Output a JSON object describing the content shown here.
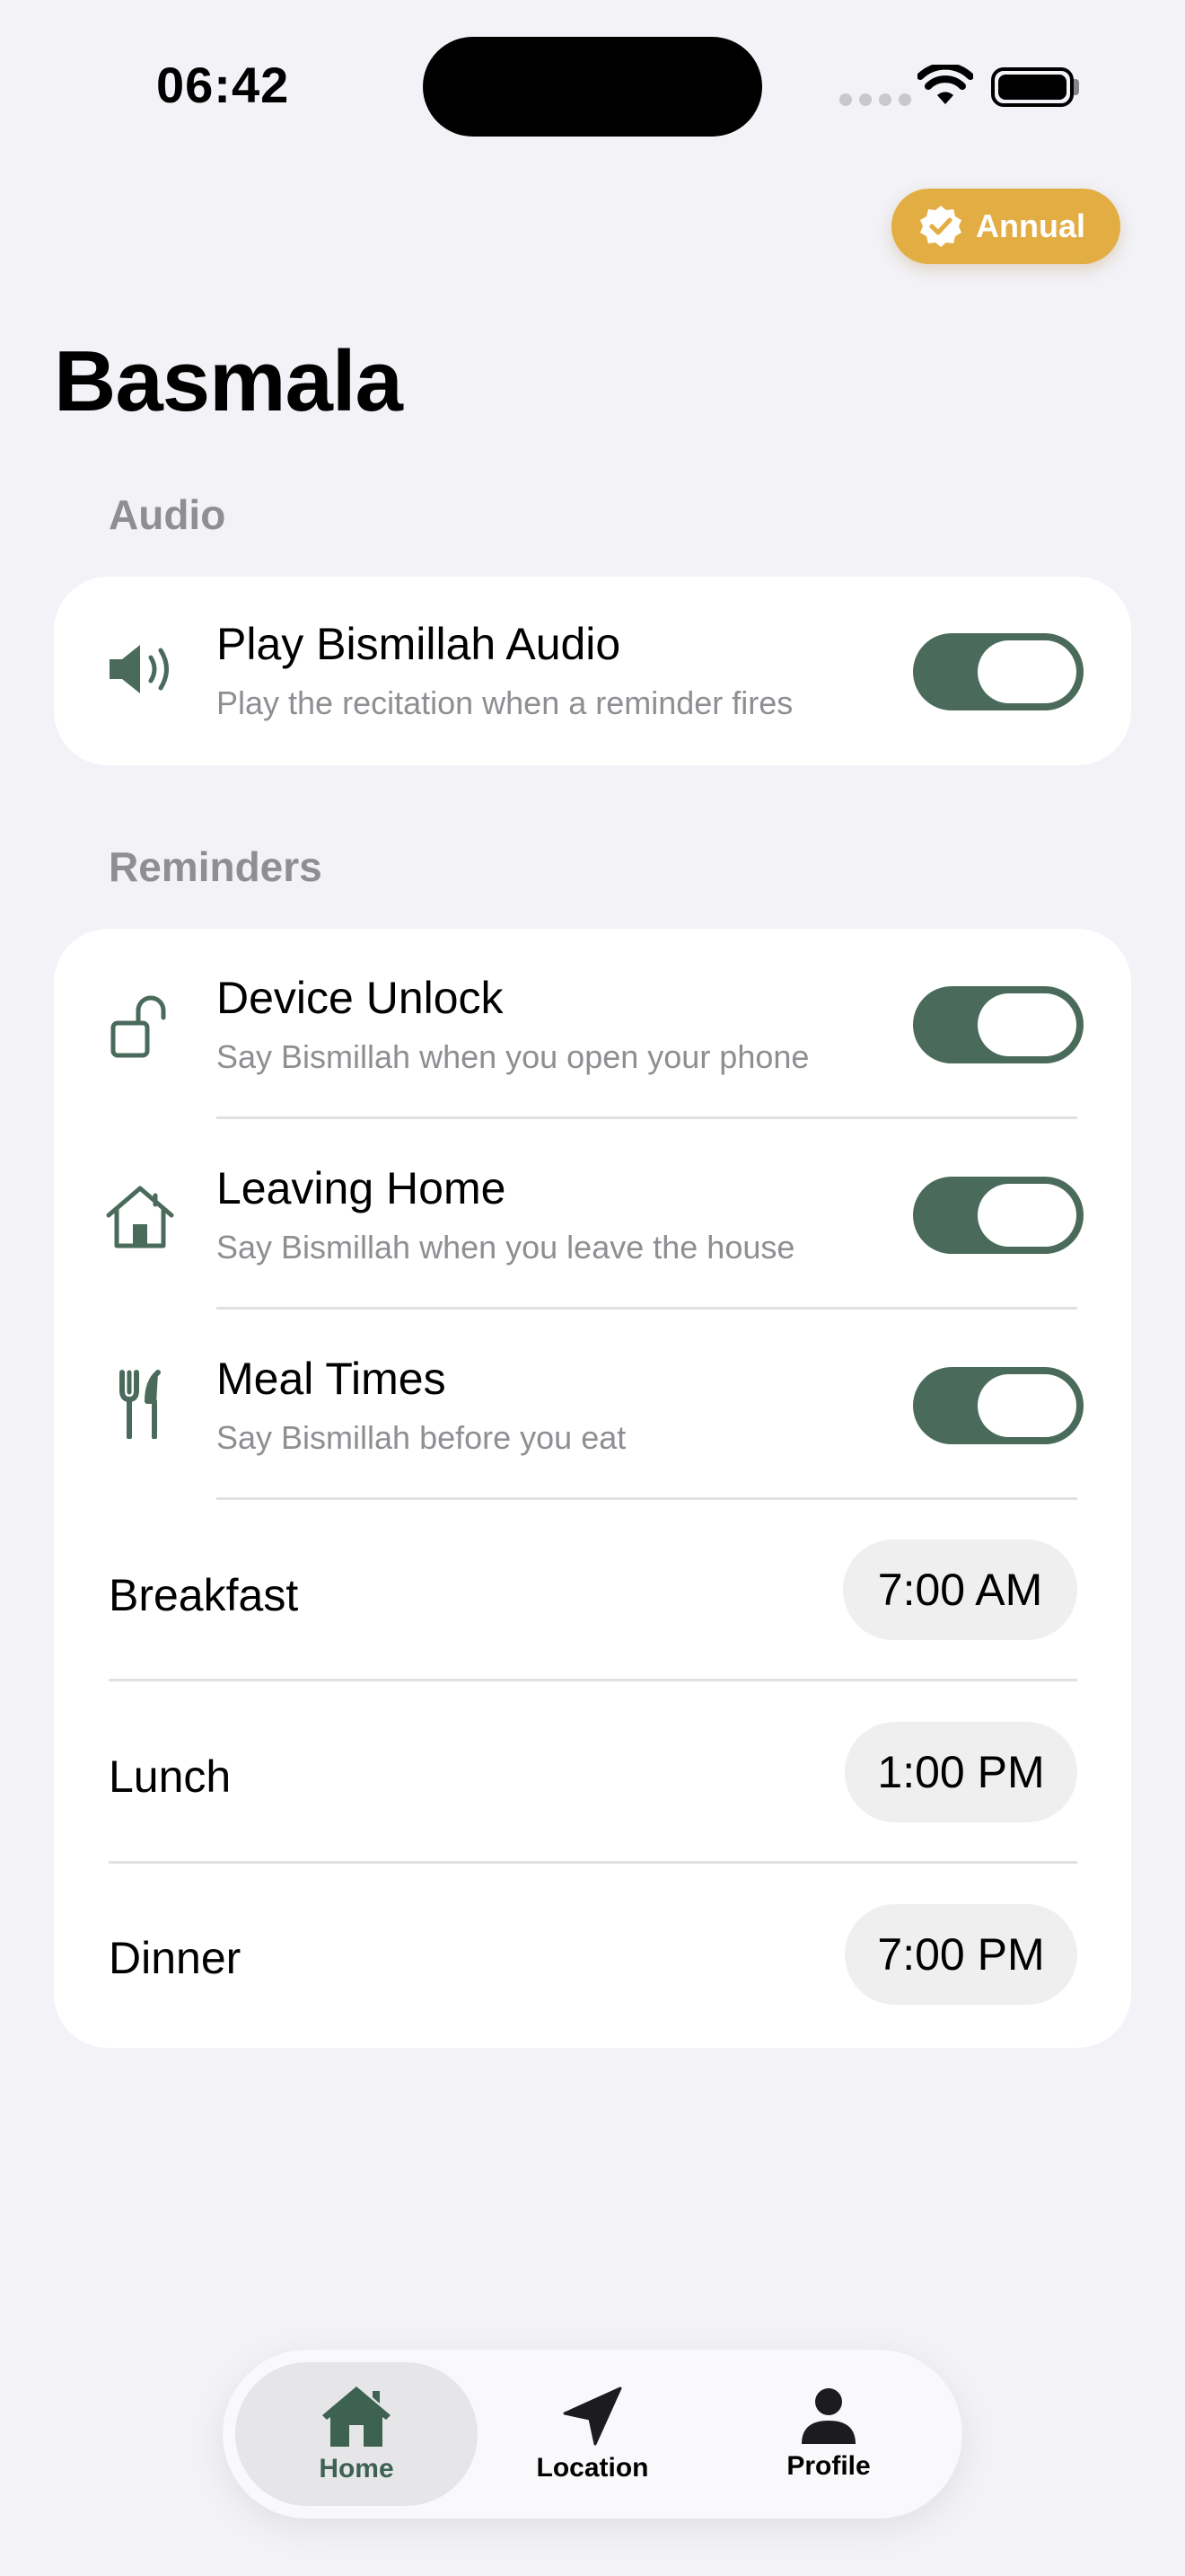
{
  "status_bar": {
    "time": "06:42"
  },
  "header": {
    "badge_label": "Annual",
    "title": "Basmala"
  },
  "audio_section": {
    "label": "Audio",
    "item": {
      "title": "Play Bismillah Audio",
      "subtitle": "Play the recitation when a reminder fires",
      "enabled": true,
      "icon": "speaker-icon"
    }
  },
  "reminders_section": {
    "label": "Reminders",
    "items": [
      {
        "title": "Device Unlock",
        "subtitle": "Say Bismillah when you open your phone",
        "enabled": true,
        "icon": "unlock-icon"
      },
      {
        "title": "Leaving Home",
        "subtitle": "Say Bismillah when you leave the house",
        "enabled": true,
        "icon": "house-icon"
      },
      {
        "title": "Meal Times",
        "subtitle": "Say Bismillah before you eat",
        "enabled": true,
        "icon": "fork-knife-icon"
      }
    ],
    "meals": [
      {
        "label": "Breakfast",
        "time": "7:00 AM"
      },
      {
        "label": "Lunch",
        "time": "1:00 PM"
      },
      {
        "label": "Dinner",
        "time": "7:00 PM"
      }
    ]
  },
  "tab_bar": {
    "tabs": [
      {
        "label": "Home",
        "icon": "house-fill-icon",
        "active": true
      },
      {
        "label": "Location",
        "icon": "location-arrow-icon",
        "active": false
      },
      {
        "label": "Profile",
        "icon": "person-icon",
        "active": false
      }
    ]
  },
  "colors": {
    "accent": "#4a6b5b",
    "badge": "#e2ad43",
    "background": "#f2f2f7"
  }
}
